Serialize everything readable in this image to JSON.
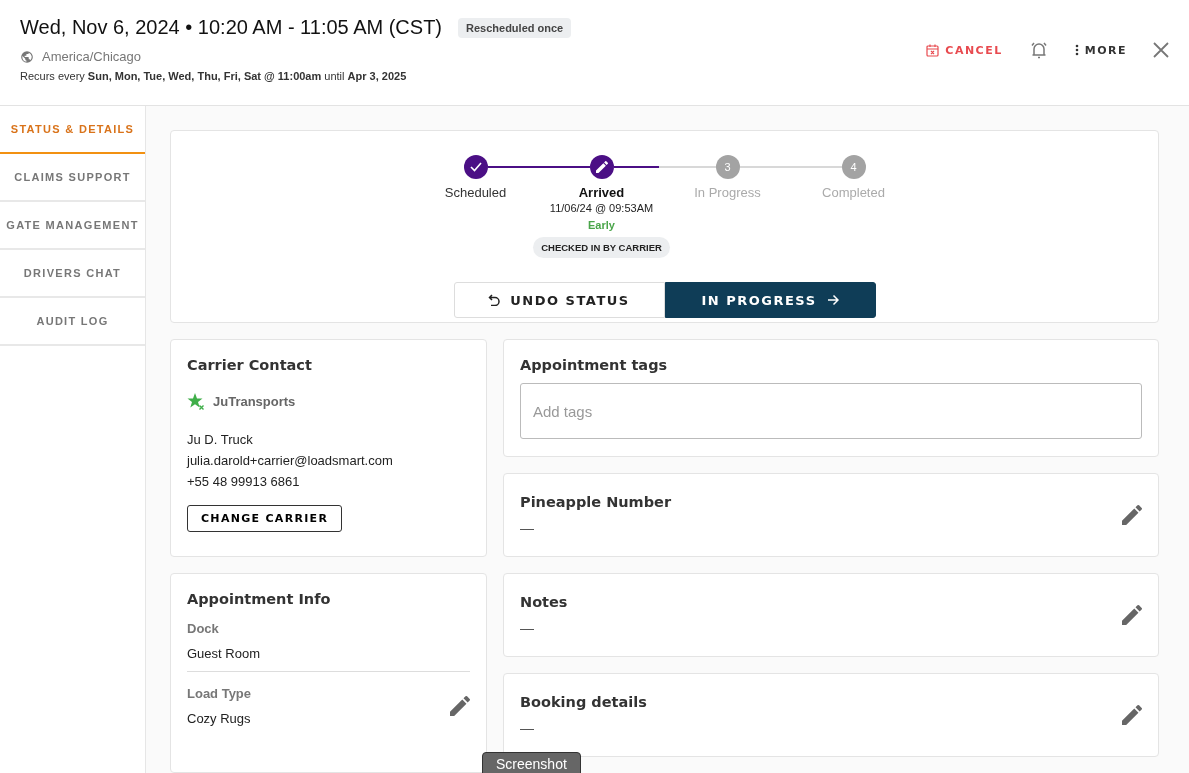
{
  "header": {
    "title": "Wed, Nov 6, 2024 • 10:20 AM - 11:05 AM (CST)",
    "badge": "Rescheduled once",
    "timezone": "America/Chicago",
    "recurrence": "Recurs every **Sun, Mon, Tue, Wed, Thu, Fri, Sat @ 11:00am** until **Apr 3, 2025**",
    "actions": [
      {
        "kind": "cancel",
        "label": "CANCEL"
      },
      {
        "kind": "alarm"
      },
      {
        "kind": "more",
        "label": "MORE"
      },
      {
        "kind": "close"
      }
    ]
  },
  "sidebar": {
    "tabs": [
      {
        "label": "STATUS & DETAILS",
        "selected": true
      },
      {
        "label": "CLAIMS SUPPORT",
        "selected": false
      },
      {
        "label": "GATE MANAGEMENT",
        "selected": false
      },
      {
        "label": "DRIVERS CHAT",
        "selected": false
      },
      {
        "label": "AUDIT LOG",
        "selected": false
      }
    ]
  },
  "status": {
    "steps": [
      {
        "label": "Scheduled",
        "kind": "done"
      },
      {
        "label": "Arrived",
        "kind": "current",
        "time": "11/06/24 @ 09:53AM",
        "timing": "Early",
        "badge": "CHECKED IN BY CARRIER"
      },
      {
        "label": "In Progress",
        "kind": "pending",
        "number": "3"
      },
      {
        "label": "Completed",
        "kind": "pending",
        "number": "4"
      }
    ],
    "buttons": [
      {
        "kind": "undo",
        "label": "UNDO STATUS"
      },
      {
        "kind": "next",
        "label": "IN PROGRESS"
      }
    ]
  },
  "carrier_contact": {
    "title": "Carrier Contact",
    "carrier": "JuTransports",
    "name": "Ju D. Truck",
    "email": "julia.darold+carrier@loadsmart.com",
    "phone": "+55 48 99913 6861",
    "button": "CHANGE CARRIER"
  },
  "appointment_info": {
    "title": "Appointment Info",
    "fields": [
      {
        "label": "Dock",
        "value": "Guest Room",
        "editable": false
      },
      {
        "label": "Load Type",
        "value": "Cozy Rugs",
        "editable": true
      }
    ]
  },
  "appointment_tags": {
    "title": "Appointment tags",
    "placeholder": "Add tags"
  },
  "detail_cards": [
    {
      "title": "Pineapple Number",
      "value": "—"
    },
    {
      "title": "Notes",
      "value": "—"
    },
    {
      "title": "Booking details",
      "value": "—"
    }
  ],
  "overlay_tooltip": "Screenshot"
}
